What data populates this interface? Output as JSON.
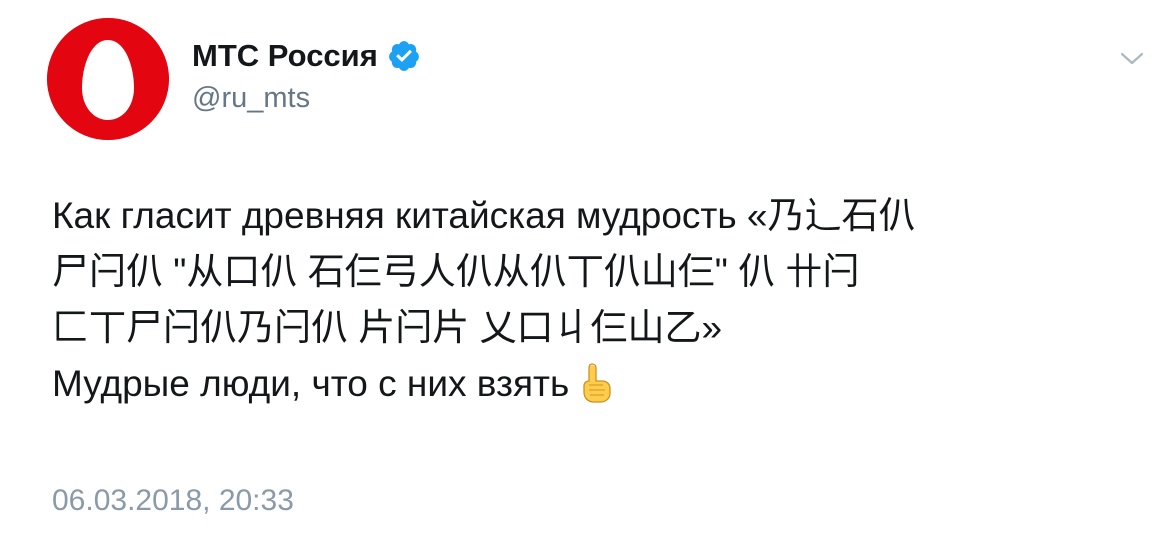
{
  "account": {
    "display_name": "МТС Россия",
    "handle": "@ru_mts",
    "verified": true,
    "avatar_icon": "mts-egg-logo",
    "brand_color": "#e30611"
  },
  "tweet": {
    "line1": "Как гласит древняя китайская мудрость «乃辶石仈",
    "line2": "尸闩仈 \"从口仈 石仨弓人仈从仈丅仈山仨\" 仈 卄闩",
    "line3": "匚丅尸闩仈乃闩仈 片闩片 乂口丩仨山乙»",
    "line4": "Мудрые люди, что с них взять",
    "emoji": "index-pointing-up-emoji"
  },
  "meta": {
    "timestamp": "06.03.2018, 20:33",
    "menu_icon": "chevron-down-icon"
  },
  "colors": {
    "text": "#14171a",
    "secondary": "#657786",
    "verified": "#1da1f2"
  }
}
